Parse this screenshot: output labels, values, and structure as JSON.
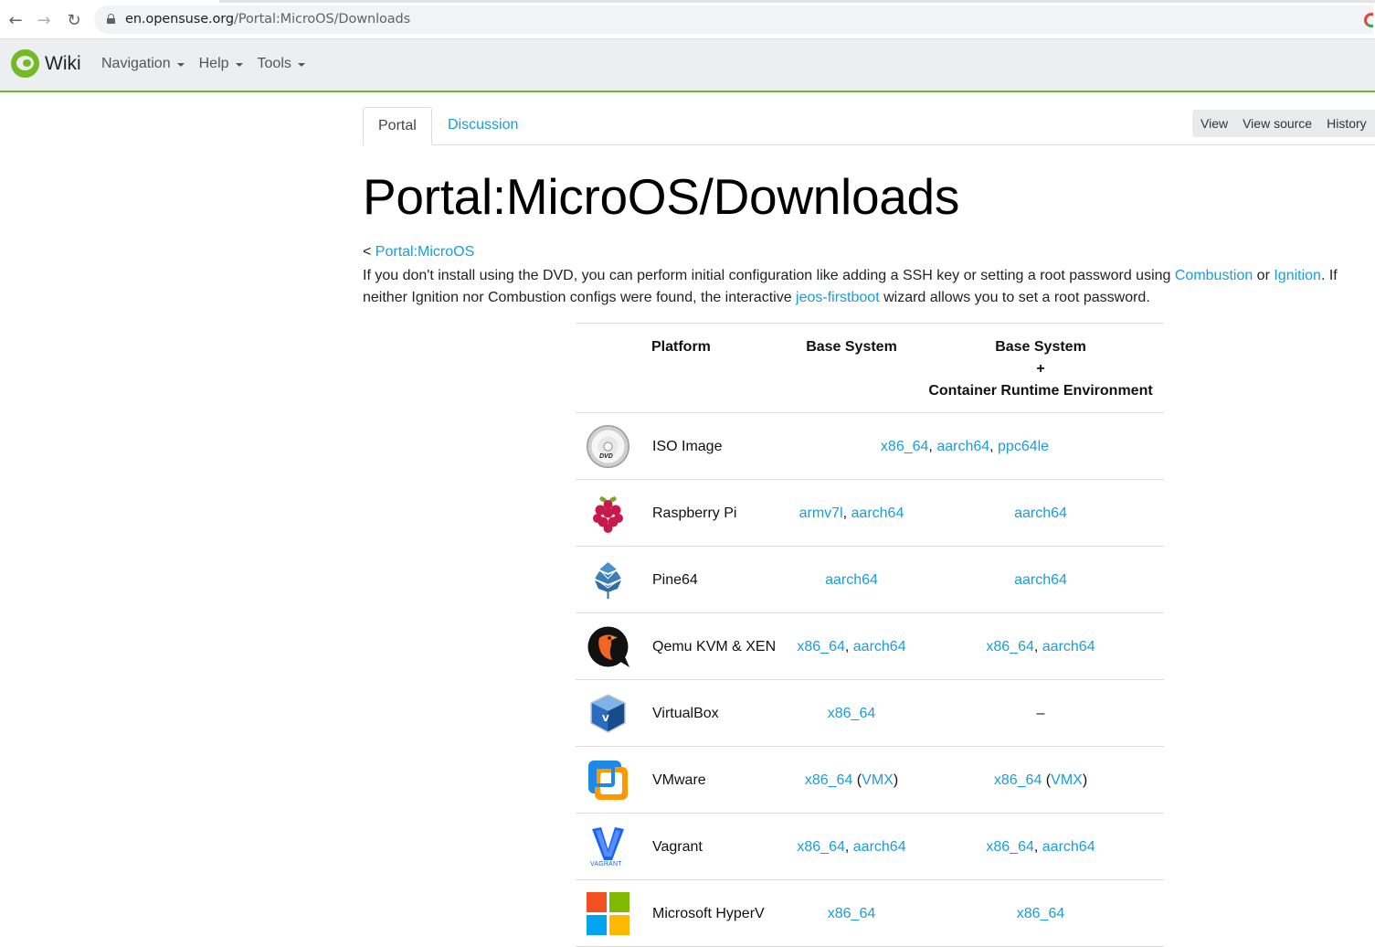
{
  "browser": {
    "url_host": "en.opensuse.org",
    "url_path": "/Portal:MicroOS/Downloads"
  },
  "navbar": {
    "brand": "Wiki",
    "menus": [
      "Navigation",
      "Help",
      "Tools"
    ]
  },
  "tabs": {
    "portal": "Portal",
    "discussion": "Discussion",
    "actions": [
      "View",
      "View source",
      "History"
    ]
  },
  "page": {
    "title": "Portal:MicroOS/Downloads",
    "breadcrumb_prefix": "< ",
    "breadcrumb_link": "Portal:MicroOS",
    "intro": {
      "t1": "If you don't install using the DVD, you can perform initial configuration like adding a SSH key or setting a root password using ",
      "link1": "Combustion",
      "t2": " or ",
      "link2": "Ignition",
      "t3": ". If neither Ignition nor Combustion configs were found, the interactive ",
      "link3": "jeos-firstboot",
      "t4": " wizard allows you to set a root password."
    }
  },
  "table": {
    "headers": {
      "platform": "Platform",
      "base": "Base System",
      "cre_line1": "Base System",
      "cre_line2": "+",
      "cre_line3": "Container Runtime Environment"
    },
    "rows": [
      {
        "icon": "dvd-icon",
        "name": "ISO Image",
        "merged": [
          "x86_64",
          "aarch64",
          "ppc64le"
        ]
      },
      {
        "icon": "raspberry-pi-icon",
        "name": "Raspberry Pi",
        "base": [
          "armv7l",
          "aarch64"
        ],
        "cre": [
          "aarch64"
        ]
      },
      {
        "icon": "pine64-icon",
        "name": "Pine64",
        "base": [
          "aarch64"
        ],
        "cre": [
          "aarch64"
        ]
      },
      {
        "icon": "qemu-icon",
        "name": "Qemu KVM & XEN",
        "base": [
          "x86_64",
          "aarch64"
        ],
        "cre": [
          "x86_64",
          "aarch64"
        ]
      },
      {
        "icon": "virtualbox-icon",
        "name": "VirtualBox",
        "base": [
          "x86_64"
        ],
        "cre_text": "–"
      },
      {
        "icon": "vmware-icon",
        "name": "VMware",
        "base_main": "x86_64",
        "base_extra": "VMX",
        "cre_main": "x86_64",
        "cre_extra": "VMX"
      },
      {
        "icon": "vagrant-icon",
        "name": "Vagrant",
        "base": [
          "x86_64",
          "aarch64"
        ],
        "cre": [
          "x86_64",
          "aarch64"
        ]
      },
      {
        "icon": "microsoft-icon",
        "name": "Microsoft HyperV",
        "base": [
          "x86_64"
        ],
        "cre": [
          "x86_64"
        ]
      }
    ],
    "dvd_label": "DVD",
    "vagrant_label": "VAGRANT"
  },
  "colors": {
    "link": "#1a9dd9",
    "accent_green": "#73ba25",
    "navbar_bg": "#eceeef"
  }
}
